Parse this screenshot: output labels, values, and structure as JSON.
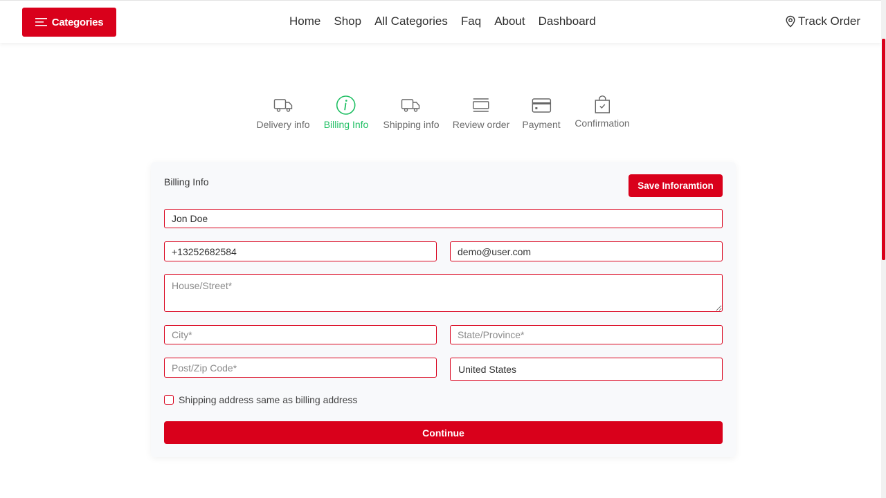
{
  "header": {
    "categories_label": "Categories",
    "nav": [
      "Home",
      "Shop",
      "All Categories",
      "Faq",
      "About",
      "Dashboard"
    ],
    "track_order_label": "Track Order"
  },
  "steps": [
    {
      "label": "Delivery info",
      "icon": "truck-icon",
      "active": false
    },
    {
      "label": "Billing Info",
      "icon": "info-icon",
      "active": true
    },
    {
      "label": "Shipping info",
      "icon": "truck-icon",
      "active": false
    },
    {
      "label": "Review order",
      "icon": "review-icon",
      "active": false
    },
    {
      "label": "Payment",
      "icon": "card-icon",
      "active": false
    },
    {
      "label": "Confirmation",
      "icon": "bag-check-icon",
      "active": false
    }
  ],
  "form": {
    "title": "Billing Info",
    "save_label": "Save Inforamtion",
    "name_value": "Jon Doe",
    "phone_value": "+13252682584",
    "email_value": "demo@user.com",
    "street_placeholder": "House/Street*",
    "city_placeholder": "City*",
    "state_placeholder": "State/Province*",
    "zip_placeholder": "Post/Zip Code*",
    "country_value": "United States",
    "same_address_label": "Shipping address same as billing address",
    "continue_label": "Continue"
  },
  "colors": {
    "accent": "#d9001b",
    "active_step": "#1fbf63"
  }
}
